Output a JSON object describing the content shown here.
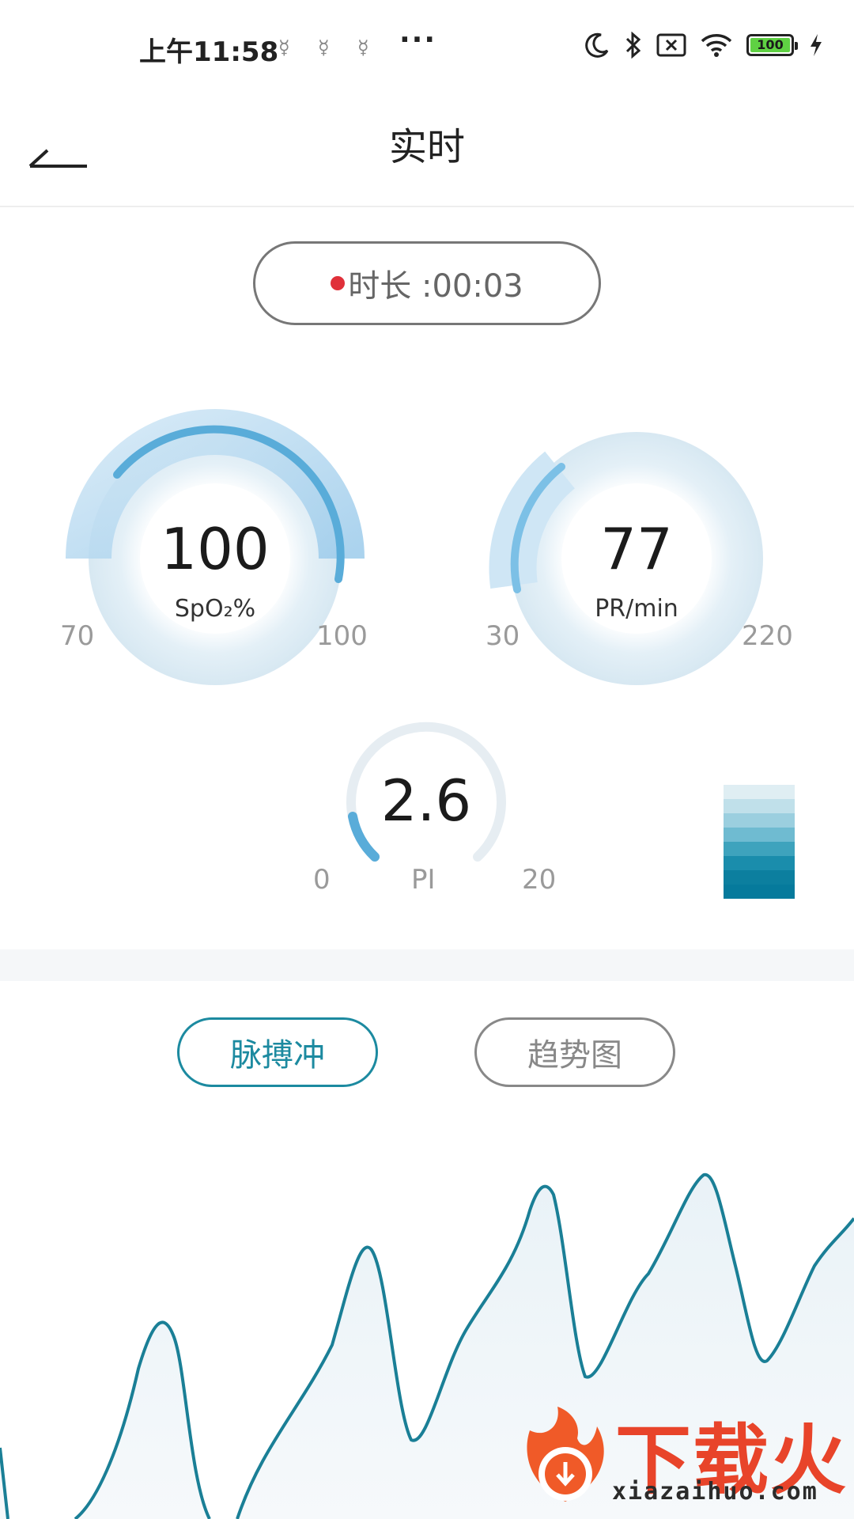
{
  "status_bar": {
    "time": "上午11:58",
    "more": "···",
    "battery_level": "100",
    "icons": [
      "notification-icon",
      "notification-icon",
      "notification-icon",
      "moon-icon",
      "bluetooth-icon",
      "no-sim-icon",
      "wifi-icon",
      "battery-icon",
      "charging-icon"
    ]
  },
  "header": {
    "title": "实时"
  },
  "recording": {
    "duration_text": "时长 :00:03"
  },
  "gauges": {
    "spo2": {
      "value": "100",
      "unit": "SpO₂%",
      "min": "70",
      "max": "100",
      "level": 1.0
    },
    "pr": {
      "value": "77",
      "unit": "PR/min",
      "min": "30",
      "max": "220",
      "level": 0.247
    },
    "pi": {
      "value": "2.6",
      "unit": "PI",
      "min": "0",
      "max": "20",
      "level": 0.13
    }
  },
  "signal_scale": {
    "colors": [
      "#dfeef3",
      "#c0e0ea",
      "#9bcfdf",
      "#6fbbd1",
      "#3ea3bd",
      "#1a8dac",
      "#0c7f9f",
      "#067a9c"
    ]
  },
  "tabs": {
    "pulse_label": "脉搏冲",
    "trend_label": "趋势图",
    "active": "pulse"
  },
  "colors": {
    "accent": "#1c8aa0",
    "gauge": "#5ab0dc",
    "record_dot": "#e0303a",
    "watermark": "#e8442a"
  },
  "watermark": {
    "cn": "下载火",
    "en": "xiazaihuo.com"
  }
}
